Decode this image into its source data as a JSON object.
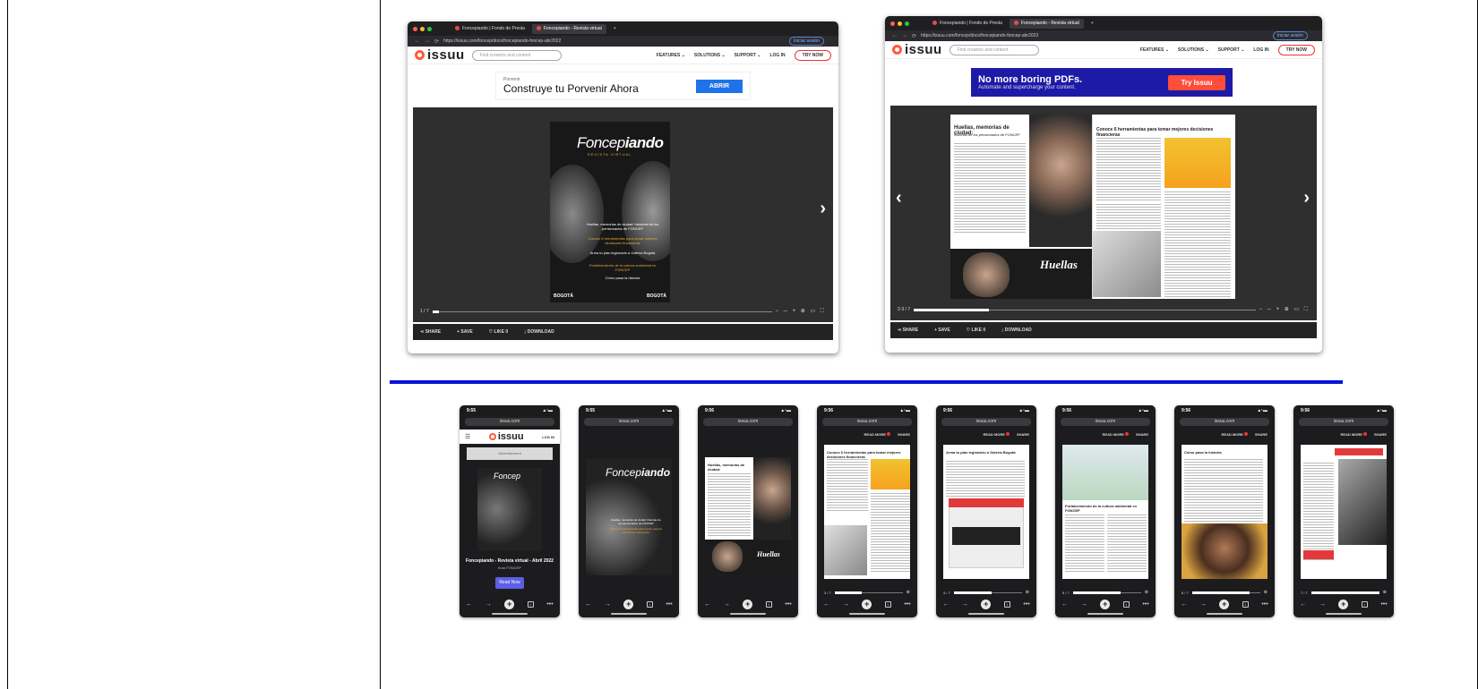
{
  "windows": [
    {
      "tabs": [
        "Foncepiando | Fondo de Presta",
        "Foncepiando - Revista virtual"
      ],
      "url": "https://issuu.com/foncep/docs/foncepiando-foncep-abr2022",
      "signin": "Iniciar sesión",
      "logo": "issuu",
      "search_placeholder": "Find creators and content",
      "nav": [
        "FEATURES ⌄",
        "SOLUTIONS ⌄",
        "SUPPORT ⌄",
        "LOG IN"
      ],
      "try": "TRY NOW",
      "ad": {
        "small": "Porvenir",
        "headline": "Construye tu Porvenir Ahora",
        "button": "ABRIR"
      },
      "page_indicator": "1 / 7",
      "actions": {
        "share": "SHARE",
        "save": "SAVE",
        "like": "LIKE",
        "like_count": "0",
        "download": "DOWNLOAD"
      }
    },
    {
      "tabs": [
        "Foncepiando | Fondo de Presta",
        "Foncepiando - Revista virtual"
      ],
      "url": "https://issuu.com/foncep/docs/foncepiando-foncep-abr2022",
      "signin": "Iniciar sesión",
      "logo": "issuu",
      "search_placeholder": "Find creators and content",
      "nav": [
        "FEATURES ⌄",
        "SOLUTIONS ⌄",
        "SUPPORT ⌄",
        "LOG IN"
      ],
      "try": "TRY NOW",
      "ad": {
        "headline": "No more boring PDFs.",
        "sub": "Automate and supercharge your content.",
        "button": "Try Issuu"
      },
      "page_indicator": "2-3 / 7",
      "actions": {
        "share": "SHARE",
        "save": "SAVE",
        "like": "LIKE",
        "like_count": "0",
        "download": "DOWNLOAD"
      }
    }
  ],
  "cover": {
    "title_a": "Foncep",
    "title_b": "iando",
    "subtitle": "REVISTA VIRTUAL",
    "lines": [
      {
        "text": "Huellas, memorias de ciudad: historias de los pensionados de FONCEP",
        "color": "#ffffff"
      },
      {
        "text": "Conoce 6 herramientas para tomar mejores decisiones financieras",
        "color": "#e6a63b"
      },
      {
        "text": "Arma tu plan legionario a Galería Bogotá",
        "color": "#ffffff"
      },
      {
        "text": "Fortalecimiento de la cultura ambiental en FONCEP",
        "color": "#e6a63b"
      },
      {
        "text": "Cómo pasa la historia",
        "color": "#ffffff"
      }
    ],
    "footer_left": "BOGOTÁ",
    "footer_right": "BOGOTÁ"
  },
  "spread": {
    "left_heading": "Huellas, memorias de ciudad:",
    "left_sub": "historias de los pensionados de FONCEP",
    "left_sign": "Huellas",
    "right_heading": "Conoce 6 herramientas para tomar mejores decisiones financieras"
  },
  "phones": [
    {
      "time": "9:55",
      "url": "issuu.com",
      "logo": "issuu",
      "login": "LOG IN",
      "ad": "Advertisement",
      "doc_title": "Foncepiando - Revista virtual - Abril 2022",
      "from": "from FONCEP",
      "read": "Read Now"
    },
    {
      "time": "9:55",
      "url": "issuu.com"
    },
    {
      "time": "9:56",
      "url": "issuu.com"
    },
    {
      "time": "9:56",
      "url": "issuu.com",
      "read_more": "READ MORE",
      "share": "SHARE",
      "page": "3 / 7",
      "heading": "Conoce 6 herramientas para tomar mejores decisiones financieras"
    },
    {
      "time": "9:56",
      "url": "issuu.com",
      "read_more": "READ MORE",
      "share": "SHARE",
      "page": "4 / 7",
      "heading": "Arma tu plan legionario a Galería Bogotá"
    },
    {
      "time": "9:56",
      "url": "issuu.com",
      "read_more": "READ MORE",
      "share": "SHARE",
      "page": "5 / 7",
      "heading": "Fortalecimiento de la cultura ambiental en FONCEP"
    },
    {
      "time": "9:56",
      "url": "issuu.com",
      "read_more": "READ MORE",
      "share": "SHARE",
      "page": "6 / 7",
      "heading": "Cómo pasa la historia"
    },
    {
      "time": "9:56",
      "url": "issuu.com",
      "read_more": "READ MORE",
      "share": "SHARE",
      "page": "7 / 7"
    }
  ]
}
